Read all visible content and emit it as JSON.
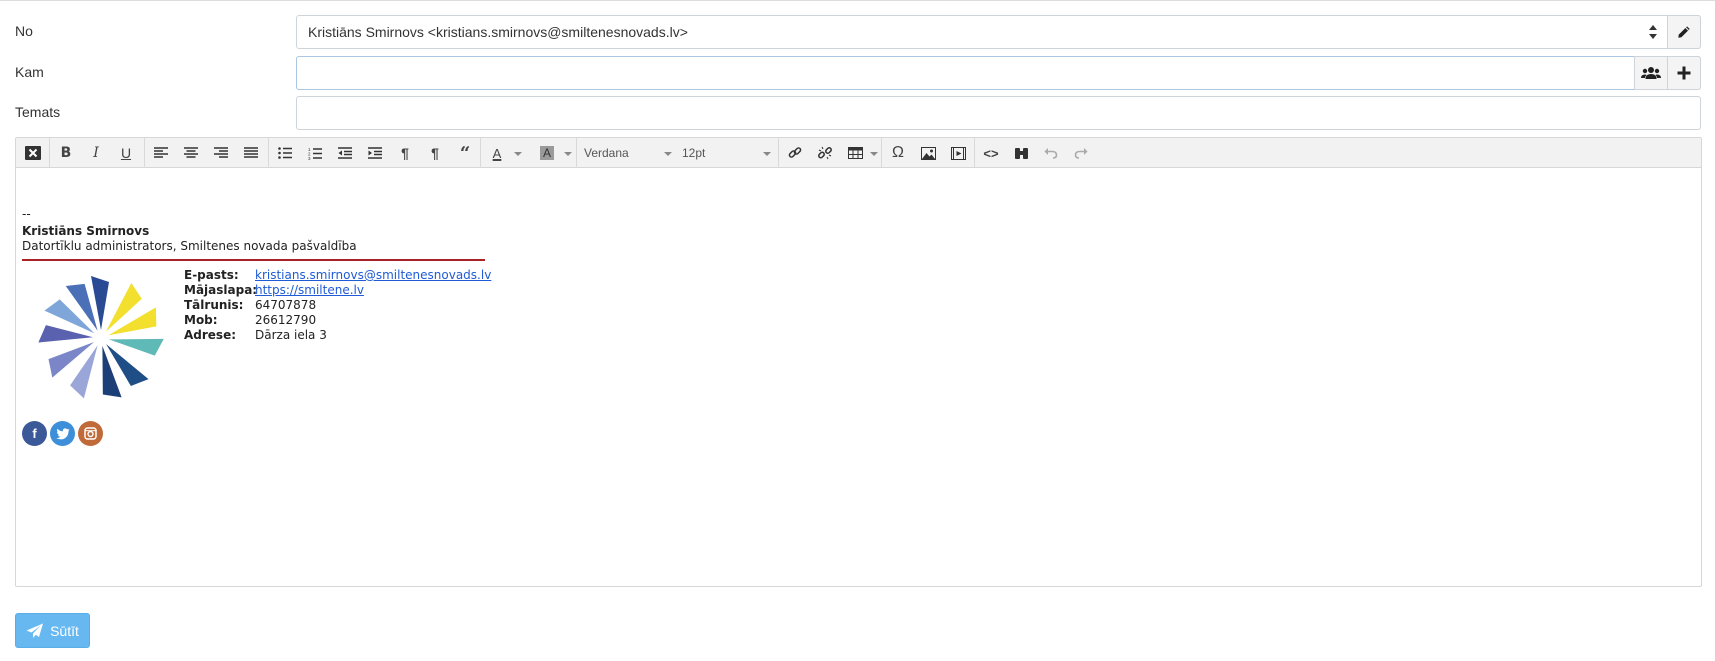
{
  "form": {
    "from_label": "No",
    "from_value": "Kristiāns Smirnovs <kristians.smirnovs@smiltenesnovads.lv>",
    "to_label": "Kam",
    "to_value": "",
    "subject_label": "Temats",
    "subject_value": ""
  },
  "editor": {
    "font_family": "Verdana",
    "font_size": "12pt"
  },
  "signature": {
    "dash": "--",
    "name": "Kristiāns Smirnovs",
    "title": "Datortīklu administrators, Smiltenes novada pašvaldība",
    "contacts": [
      {
        "key": "E-pasts:",
        "value": "kristians.smirnovs@smiltenesnovads.lv",
        "link": true
      },
      {
        "key": "Mājaslapa:",
        "value": "https://smiltene.lv",
        "link": true
      },
      {
        "key": "Tālrunis:",
        "value": "64707878",
        "link": false
      },
      {
        "key": "Mob:",
        "value": "26612790",
        "link": false
      },
      {
        "key": "Adrese:",
        "value": "Dārza iela 3",
        "link": false
      }
    ]
  },
  "actions": {
    "send_label": "Sūtīt"
  },
  "colors": {
    "accent": "#67b8f0",
    "signature_line": "#a82226",
    "facebook": "#3b5998",
    "twitter": "#3c8fd8",
    "instagram": "#c06a3a"
  },
  "icons": [
    "pencil-icon",
    "users-icon",
    "plus-icon",
    "paper-plane-icon",
    "facebook-icon",
    "twitter-icon",
    "instagram-icon"
  ]
}
